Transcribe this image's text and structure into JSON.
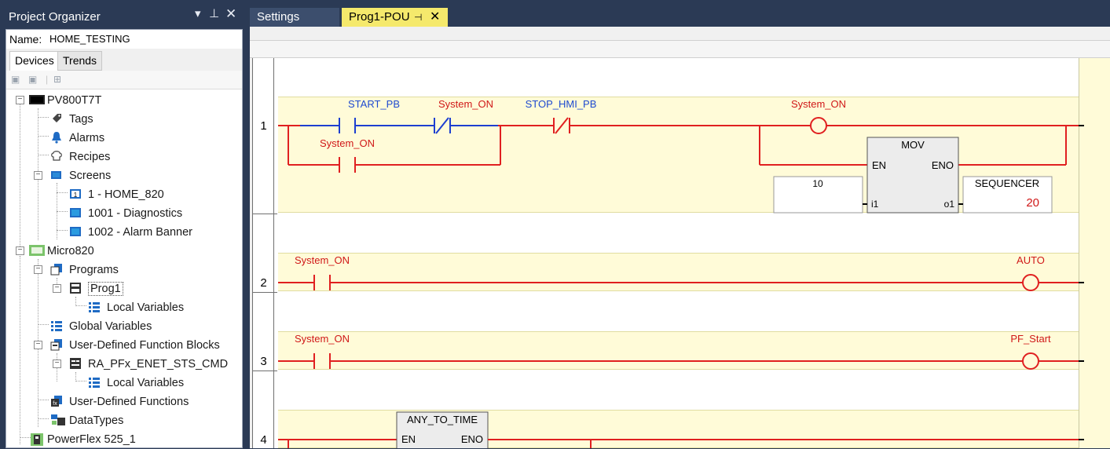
{
  "organizer": {
    "title": "Project Organizer",
    "name_label": "Name:",
    "name_value": "HOME_TESTING",
    "tabs": [
      "Devices",
      "Trends"
    ],
    "tree": [
      {
        "label": "PV800T7T",
        "icon": "hmi-device-icon"
      },
      {
        "label": "Tags",
        "icon": "tag-icon"
      },
      {
        "label": "Alarms",
        "icon": "bell-icon"
      },
      {
        "label": "Recipes",
        "icon": "chef-hat-icon"
      },
      {
        "label": "Screens",
        "icon": "screens-icon"
      },
      {
        "label": "1 - HOME_820",
        "icon": "home-screen-icon"
      },
      {
        "label": "1001 - Diagnostics",
        "icon": "screen-icon"
      },
      {
        "label": "1002 - Alarm Banner",
        "icon": "screen-icon"
      },
      {
        "label": "Micro820",
        "icon": "controller-icon"
      },
      {
        "label": "Programs",
        "icon": "programs-icon"
      },
      {
        "label": "Prog1",
        "icon": "program-icon"
      },
      {
        "label": "Local Variables",
        "icon": "variables-list-icon"
      },
      {
        "label": "Global Variables",
        "icon": "variables-list-icon"
      },
      {
        "label": "User-Defined Function Blocks",
        "icon": "function-blocks-icon"
      },
      {
        "label": "RA_PFx_ENET_STS_CMD",
        "icon": "function-block-icon"
      },
      {
        "label": "Local Variables",
        "icon": "variables-list-icon"
      },
      {
        "label": "User-Defined Functions",
        "icon": "functions-icon"
      },
      {
        "label": "DataTypes",
        "icon": "datatypes-icon"
      },
      {
        "label": "PowerFlex 525_1",
        "icon": "drive-icon"
      }
    ]
  },
  "editor": {
    "tabs": [
      {
        "label": "Settings"
      },
      {
        "label": "Prog1-POU"
      }
    ],
    "rungs": [
      {
        "number": "1"
      },
      {
        "number": "2"
      },
      {
        "number": "3"
      },
      {
        "number": "4"
      }
    ],
    "labels": {
      "r1_start_pb": "START_PB",
      "r1_system_on_nc": "System_ON",
      "r1_stop_hmi_pb": "STOP_HMI_PB",
      "r1_system_on_branch": "System_ON",
      "r1_coil": "System_ON",
      "r1_mov_title": "MOV",
      "r1_mov_en": "EN",
      "r1_mov_eno": "ENO",
      "r1_mov_i1": "i1",
      "r1_mov_o1": "o1",
      "r1_input_value": "10",
      "r1_output_name": "SEQUENCER",
      "r1_output_value": "20",
      "r2_contact": "System_ON",
      "r2_coil": "AUTO",
      "r3_contact": "System_ON",
      "r3_coil": "PF_Start",
      "r4_block_title": "ANY_TO_TIME",
      "r4_en": "EN",
      "r4_eno": "ENO"
    },
    "colors": {
      "rung_wire": "#e02020",
      "energized_wire": "#1e3fd0",
      "label_red": "#d01818",
      "label_blue": "#1e4ad0",
      "rung_band": "#fffbd8",
      "active_tab": "#f5e96c"
    }
  }
}
